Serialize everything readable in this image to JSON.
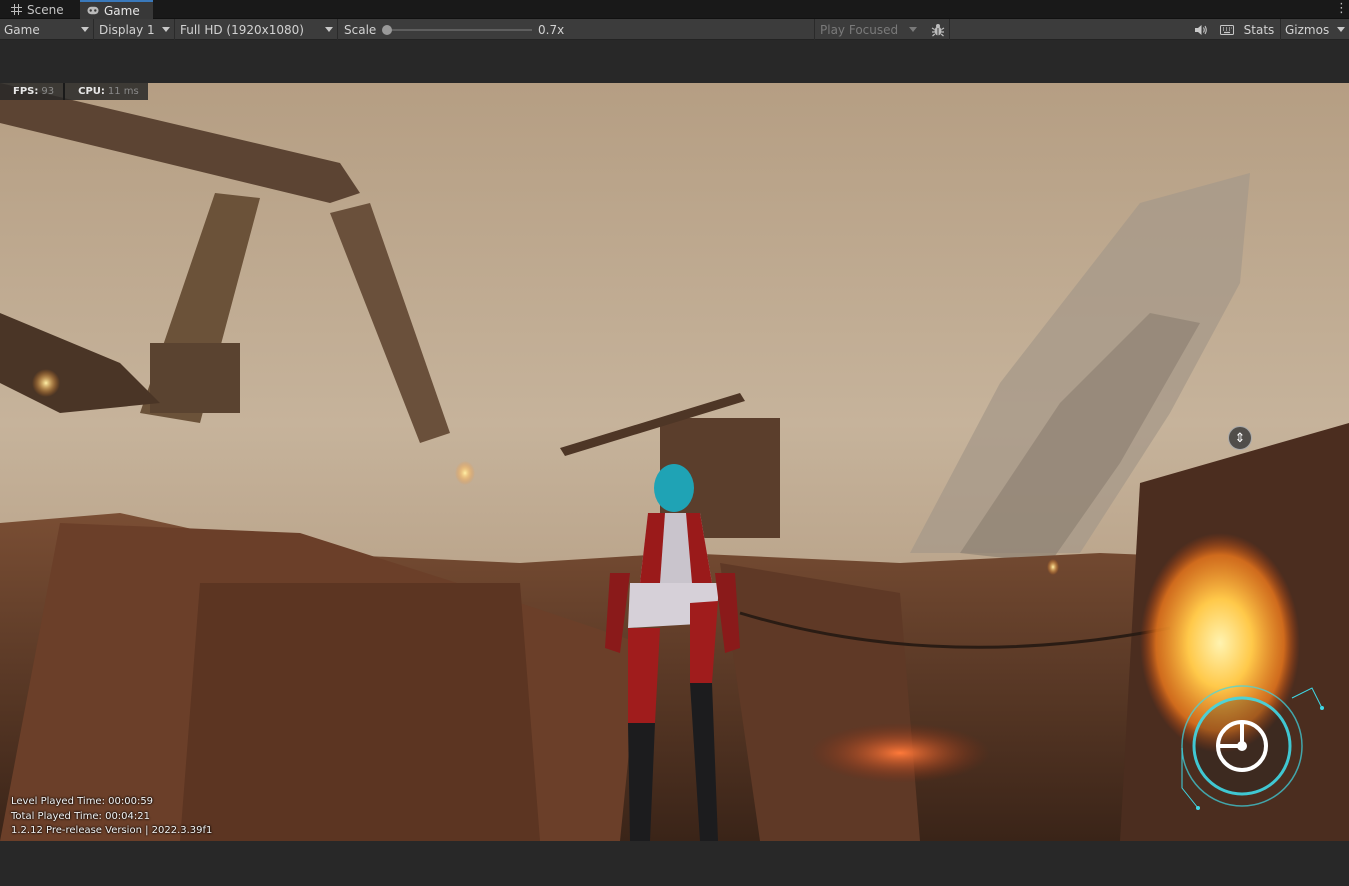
{
  "tabs": {
    "scene": "Scene",
    "game": "Game"
  },
  "toolbar": {
    "mode": "Game",
    "display": "Display 1",
    "resolution": "Full HD (1920x1080)",
    "scale_label": "Scale",
    "scale_value": "0.7x",
    "play_mode": "Play Focused",
    "stats": "Stats",
    "gizmos": "Gizmos"
  },
  "overlay": {
    "fps_label": "FPS:",
    "fps_value": "93",
    "cpu_label": "CPU:",
    "cpu_value": "11 ms"
  },
  "info": {
    "level_time": "Level Played Time: 00:00:59",
    "total_time": "Total Played Time: 00:04:21",
    "version": "1.2.12 Pre-release Version | 2022.3.39f1"
  },
  "colors": {
    "accent": "#3a79bb",
    "hud_cyan": "#3fd8e6"
  },
  "icons": [
    "grid-icon",
    "gamepad-icon",
    "bug-icon",
    "speaker-icon",
    "keyboard-icon",
    "kebab-menu-icon",
    "compass-icon",
    "radar-icon"
  ]
}
